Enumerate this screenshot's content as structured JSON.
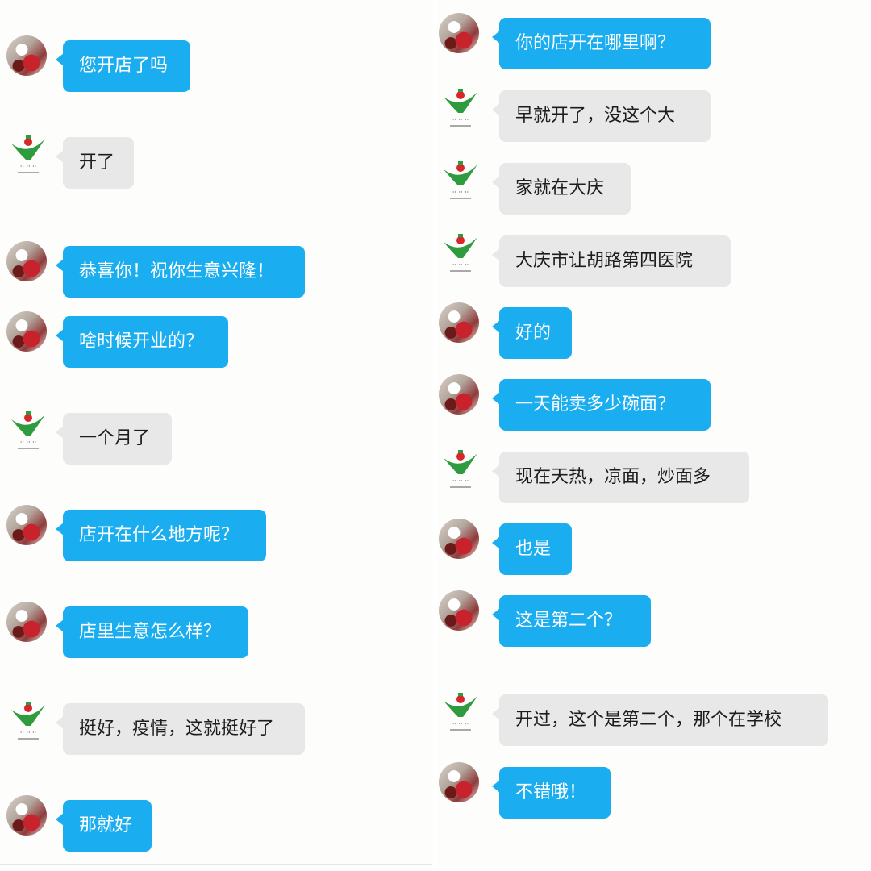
{
  "colors": {
    "outgoing_bubble": "#1aaef0",
    "incoming_bubble": "#e8e8e8",
    "outgoing_text": "#ffffff",
    "incoming_text": "#1d1d1d"
  },
  "avatars": {
    "me": "photo-avatar",
    "them": "logo-avatar"
  },
  "left_chat": [
    {
      "sender": "me",
      "text": "您开店了吗"
    },
    {
      "sender": "them",
      "text": "开了"
    },
    {
      "sender": "me",
      "text": "恭喜你！祝你生意兴隆！"
    },
    {
      "sender": "me",
      "text": "啥时候开业的？"
    },
    {
      "sender": "them",
      "text": "一个月了"
    },
    {
      "sender": "me",
      "text": "店开在什么地方呢？"
    },
    {
      "sender": "me",
      "text": "店里生意怎么样？"
    },
    {
      "sender": "them",
      "text": "挺好，疫情，这就挺好了"
    },
    {
      "sender": "me",
      "text": "那就好"
    }
  ],
  "right_chat": [
    {
      "sender": "me",
      "text": "你的店开在哪里啊？"
    },
    {
      "sender": "them",
      "text": "早就开了，没这个大"
    },
    {
      "sender": "them",
      "text": "家就在大庆"
    },
    {
      "sender": "them",
      "text": "大庆市让胡路第四医院"
    },
    {
      "sender": "me",
      "text": "好的"
    },
    {
      "sender": "me",
      "text": "一天能卖多少碗面？"
    },
    {
      "sender": "them",
      "text": "现在天热，凉面，炒面多"
    },
    {
      "sender": "me",
      "text": "也是"
    },
    {
      "sender": "me",
      "text": "这是第二个？"
    },
    {
      "sender": "them",
      "text": "开过，这个是第二个，那个在学校"
    },
    {
      "sender": "me",
      "text": "不错哦！"
    }
  ]
}
